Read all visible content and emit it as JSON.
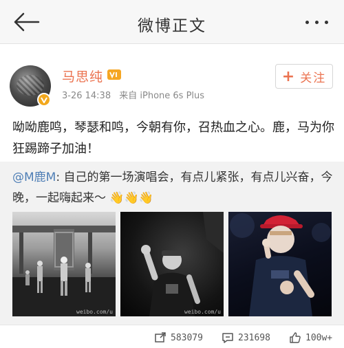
{
  "nav": {
    "title": "微博正文"
  },
  "post": {
    "username": "马思纯",
    "timestamp": "3-26 14:38",
    "source": "来自 iPhone 6s Plus",
    "follow_label": "关注",
    "follow_plus": "+",
    "content": "呦呦鹿鸣，琴瑟和鸣，今朝有你，召热血之心。鹿，马为你狂踢蹄子加油！"
  },
  "repost": {
    "mention": "@M鹿M",
    "separator": ":",
    "text": " 自己的第一场演唱会，有点儿紧张，有点儿兴奋，今晚，一起嗨起来～",
    "emoji": "👋👋👋",
    "photos": [
      {
        "watermark": "weibo.com/u"
      },
      {
        "watermark": "weibo.com/u"
      },
      {
        "watermark": ""
      }
    ]
  },
  "footer": {
    "reposts": "583079",
    "comments": "231698",
    "likes": "100w+"
  },
  "colors": {
    "accent": "#eb7350",
    "link": "#4e7eb5",
    "badge": "#f2a81d"
  },
  "icons": [
    "back-arrow-icon",
    "more-icon",
    "verified-icon",
    "vip-icon",
    "repost-icon",
    "comment-icon",
    "like-icon"
  ]
}
